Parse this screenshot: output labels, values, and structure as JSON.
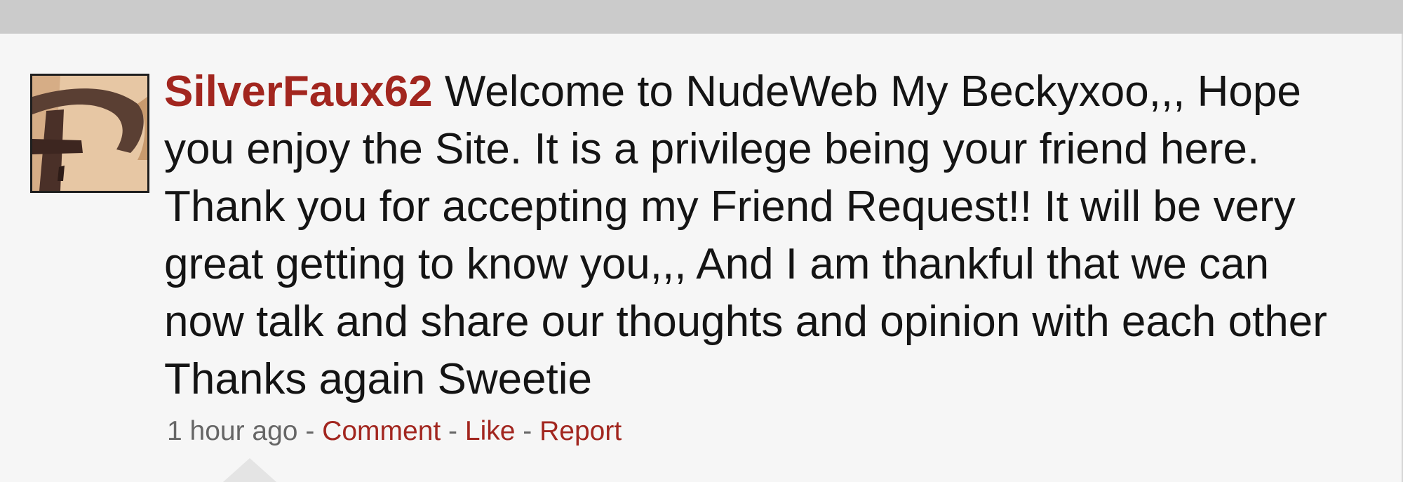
{
  "post": {
    "username": "SilverFaux62",
    "message": "Welcome to NudeWeb My Beckyxoo,,, Hope you enjoy the Site. It is a privilege being your friend here. Thank you for accepting my Friend Request!! It will be very great getting to know you,,, And I am thankful that we can now talk and share our thoughts and opinion with each other Thanks again Sweetie",
    "timestamp": "1 hour ago",
    "separator": " - ",
    "actions": {
      "comment": "Comment",
      "like": "Like",
      "report": "Report"
    }
  },
  "colors": {
    "link": "#a2261f",
    "timestamp": "#666666",
    "card_background": "#f6f6f6",
    "top_bar": "#cbcbcb"
  },
  "icons": {
    "avatar": "profile-photo"
  }
}
